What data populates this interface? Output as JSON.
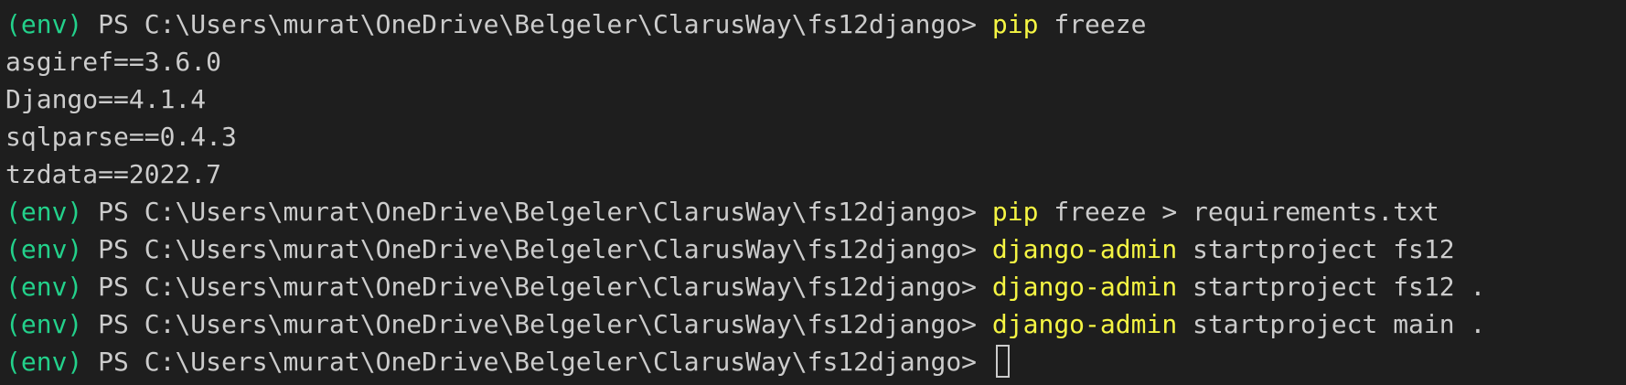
{
  "terminal": {
    "env_label": "(env)",
    "prompt": " PS C:\\Users\\murat\\OneDrive\\Belgeler\\ClarusWay\\fs12django> ",
    "colors": {
      "background": "#1e1e1e",
      "env": "#23d18b",
      "command": "#f5f543",
      "text": "#cccccc"
    },
    "lines": [
      {
        "type": "prompt",
        "cmd": "pip",
        "args": " freeze"
      },
      {
        "type": "output",
        "text": "asgiref==3.6.0"
      },
      {
        "type": "output",
        "text": "Django==4.1.4"
      },
      {
        "type": "output",
        "text": "sqlparse==0.4.3"
      },
      {
        "type": "output",
        "text": "tzdata==2022.7"
      },
      {
        "type": "prompt",
        "cmd": "pip",
        "args": " freeze > requirements.txt"
      },
      {
        "type": "prompt",
        "cmd": "django-admin",
        "args": " startproject fs12"
      },
      {
        "type": "prompt",
        "cmd": "django-admin",
        "args": " startproject fs12 ."
      },
      {
        "type": "prompt",
        "cmd": "django-admin",
        "args": " startproject main ."
      },
      {
        "type": "prompt",
        "cmd": "",
        "args": ""
      }
    ]
  }
}
